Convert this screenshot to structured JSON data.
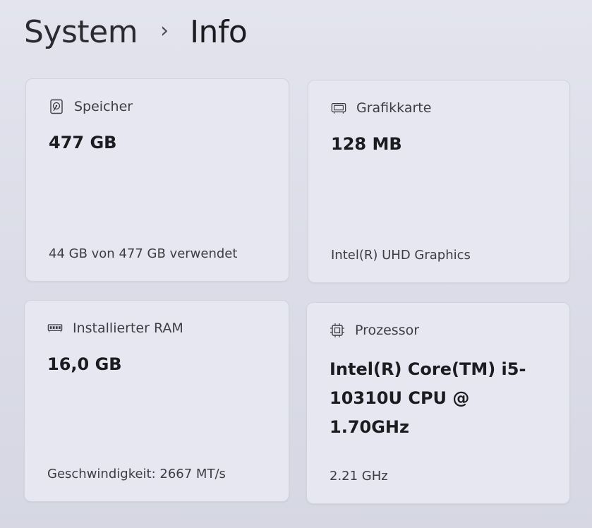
{
  "breadcrumb": {
    "parent": "System",
    "separator": "›",
    "current": "Info"
  },
  "cards": {
    "storage": {
      "icon": "hard-drive-icon",
      "label": "Speicher",
      "value": "477 GB",
      "detail": "44 GB von 477 GB verwendet"
    },
    "gpu": {
      "icon": "display-adapter-icon",
      "label": "Grafikkarte",
      "value": "128 MB",
      "detail": "Intel(R) UHD Graphics"
    },
    "ram": {
      "icon": "memory-module-icon",
      "label": "Installierter RAM",
      "value": "16,0 GB",
      "detail": "Geschwindigkeit: 2667 MT/s"
    },
    "cpu": {
      "icon": "processor-chip-icon",
      "label": "Prozessor",
      "value": "Intel(R) Core(TM) i5-10310U CPU @ 1.70GHz",
      "detail": "2.21 GHz"
    }
  }
}
